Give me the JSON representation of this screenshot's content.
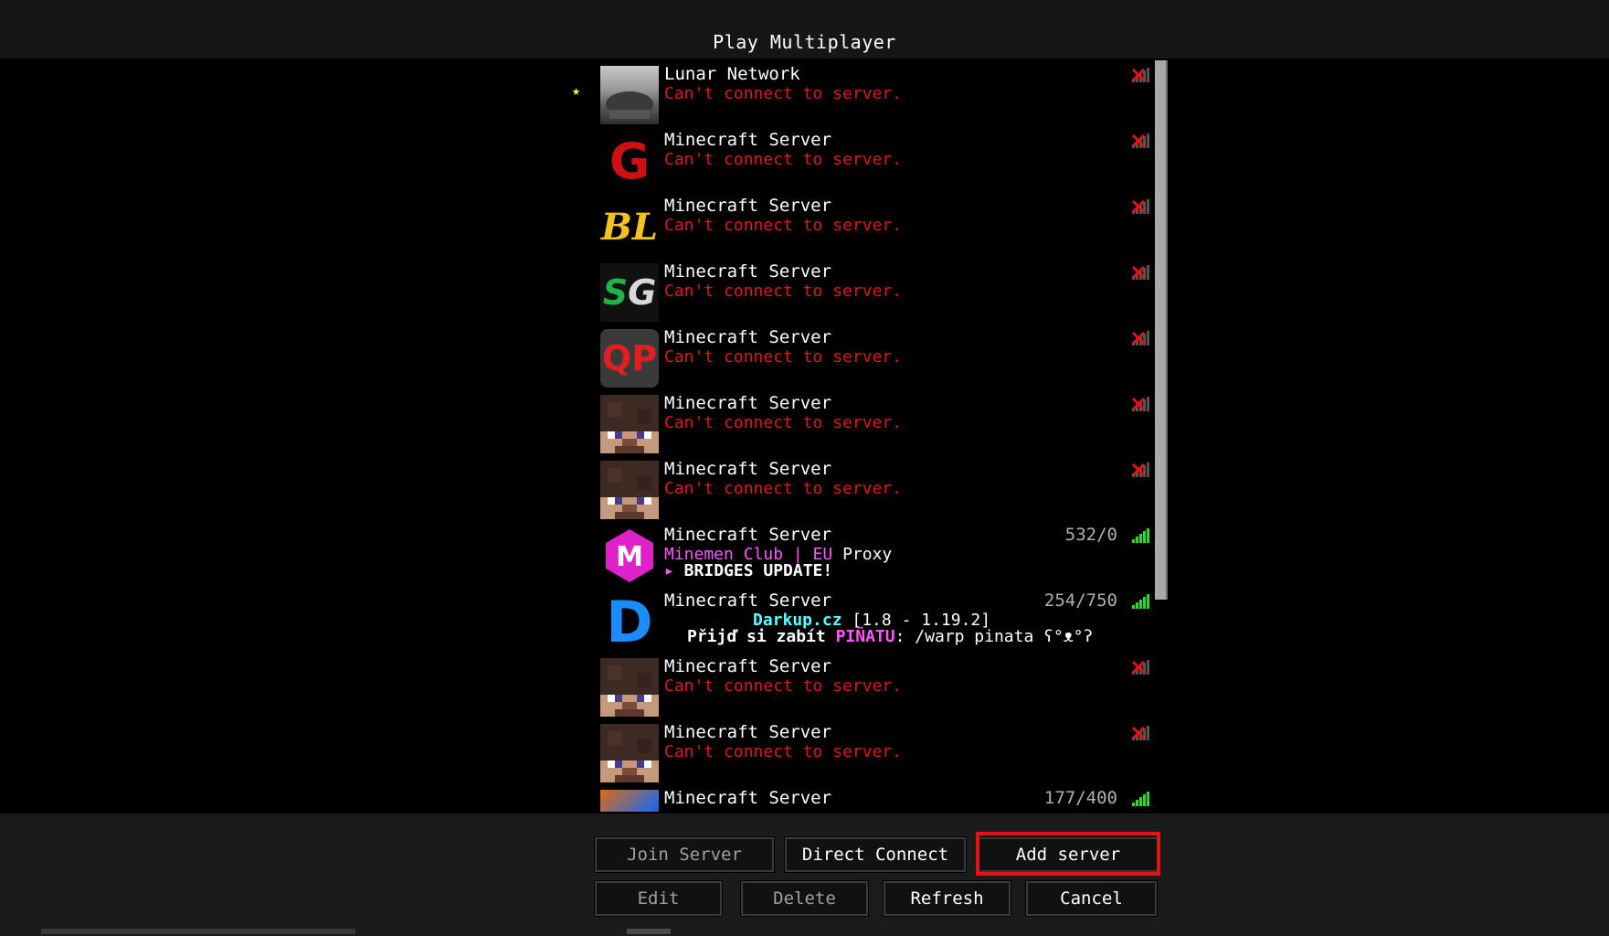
{
  "title": "Play Multiplayer",
  "entries": [
    {
      "name": "Lunar Network",
      "motd": "Can't connect to server.",
      "status": "error",
      "icon": "lunar-landscape-icon",
      "favorite": true
    },
    {
      "name": "Minecraft Server",
      "motd": "Can't connect to server.",
      "status": "error",
      "icon": "red-g-logo-icon"
    },
    {
      "name": "Minecraft Server",
      "motd": "Can't connect to server.",
      "status": "error",
      "icon": "bl-logo-icon"
    },
    {
      "name": "Minecraft Server",
      "motd": "Can't connect to server.",
      "status": "error",
      "icon": "sg-logo-icon"
    },
    {
      "name": "Minecraft Server",
      "motd": "Can't connect to server.",
      "status": "error",
      "icon": "qp-logo-icon"
    },
    {
      "name": "Minecraft Server",
      "motd": "Can't connect to server.",
      "status": "error",
      "icon": "default-steve-icon"
    },
    {
      "name": "Minecraft Server",
      "motd": "Can't connect to server.",
      "status": "error",
      "icon": "default-steve-icon"
    },
    {
      "name": "Minecraft Server",
      "motd_a1": "Minemen Club | EU",
      "motd_a2": " Proxy",
      "motd_b1": "▸",
      "motd_b2": " BRIDGES UPDATE!",
      "players": "532/0",
      "status": "online",
      "icon": "minemen-m-icon"
    },
    {
      "name": "Minecraft Server",
      "motd_a1": "Darkup.cz",
      "motd_a2": " [1.8 - 1.19.2]",
      "motd_b1": "Přijď si zabít ",
      "motd_b2": "PIÑATU",
      "motd_b3": ": /warp pinata ʕ°ᴥ°ʔ",
      "players": "254/750",
      "status": "online",
      "icon": "darkup-d-icon"
    },
    {
      "name": "Minecraft Server",
      "motd": "Can't connect to server.",
      "status": "error",
      "icon": "default-steve-icon"
    },
    {
      "name": "Minecraft Server",
      "motd": "Can't connect to server.",
      "status": "error",
      "icon": "default-steve-icon"
    },
    {
      "name": "Minecraft Server",
      "players": "177/400",
      "status": "online",
      "icon": "dragon-art-icon"
    }
  ],
  "buttons": {
    "join": "Join Server",
    "direct": "Direct Connect",
    "add": "Add server",
    "edit": "Edit",
    "delete": "Delete",
    "refresh": "Refresh",
    "cancel": "Cancel"
  },
  "colors": {
    "error": "#e01616",
    "signal": "#22dd22",
    "highlight": "#e01414",
    "minemen_pink": "#ff55ff",
    "darkup_cyan": "#55ffff"
  }
}
